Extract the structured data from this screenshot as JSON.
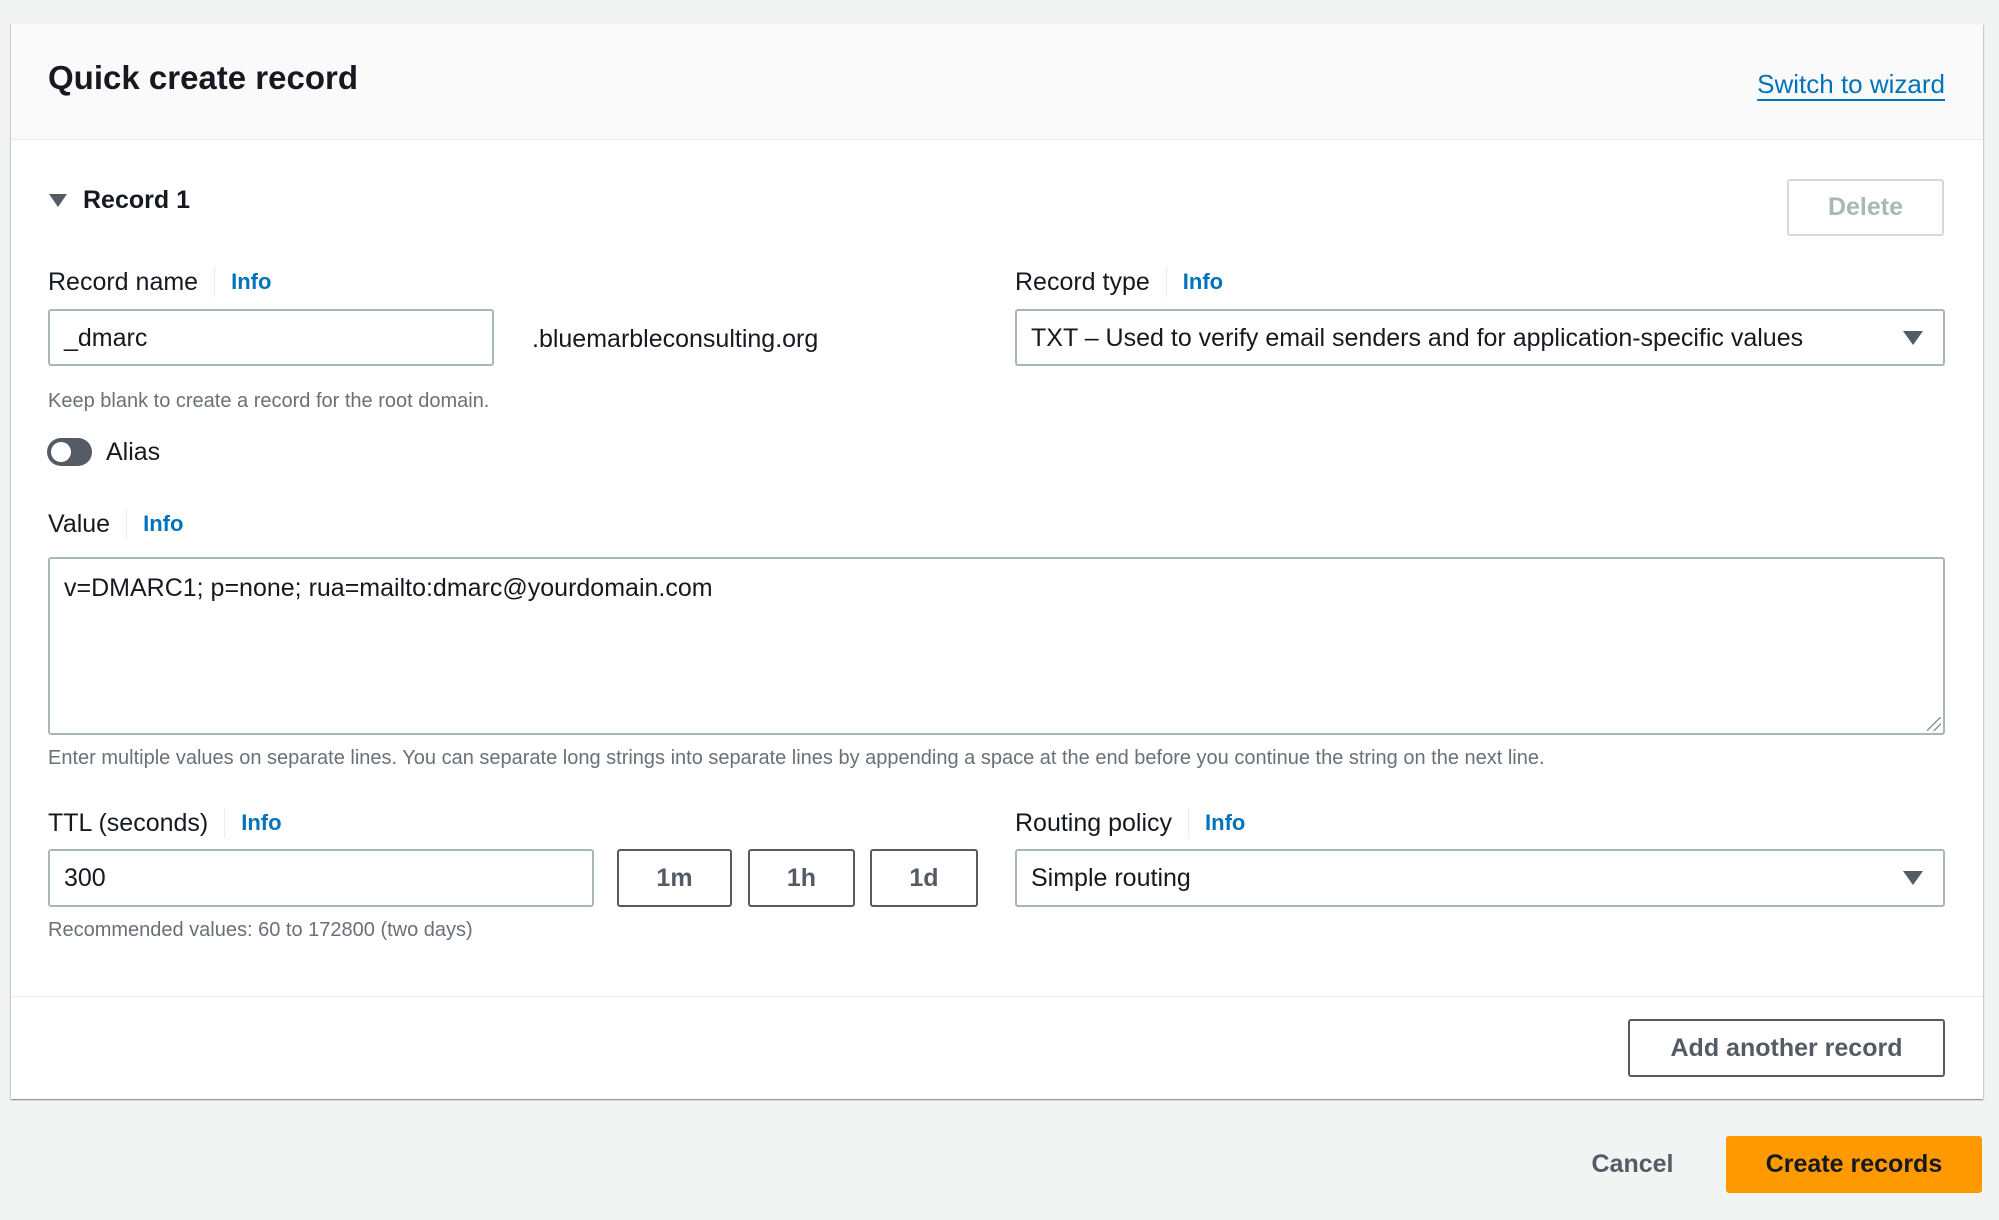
{
  "header": {
    "title": "Quick create record",
    "switch_link": "Switch to wizard"
  },
  "record": {
    "expander_label": "Record 1",
    "expanded": true,
    "delete_label": "Delete",
    "delete_disabled": true,
    "record_name": {
      "label": "Record name",
      "info": "Info",
      "value": "_dmarc",
      "domain_suffix": ".bluemarbleconsulting.org",
      "helper": "Keep blank to create a record for the root domain."
    },
    "record_type": {
      "label": "Record type",
      "info": "Info",
      "selected": "TXT – Used to verify email senders and for application-specific values"
    },
    "alias": {
      "label": "Alias",
      "enabled": false
    },
    "value": {
      "label": "Value",
      "info": "Info",
      "text": "v=DMARC1; p=none; rua=mailto:dmarc@yourdomain.com",
      "helper": "Enter multiple values on separate lines. You can separate long strings into separate lines by appending a space at the end before you continue the string on the next line."
    },
    "ttl": {
      "label": "TTL (seconds)",
      "info": "Info",
      "value": "300",
      "presets": [
        "1m",
        "1h",
        "1d"
      ],
      "helper": "Recommended values: 60 to 172800 (two days)"
    },
    "routing_policy": {
      "label": "Routing policy",
      "info": "Info",
      "selected": "Simple routing"
    }
  },
  "add_another_label": "Add another record",
  "actions": {
    "cancel": "Cancel",
    "create": "Create records"
  },
  "colors": {
    "primary": "#ff9900",
    "link": "#0073bb",
    "text": "#16191f",
    "secondary_text": "#687078",
    "background": "#f2f3f3"
  }
}
